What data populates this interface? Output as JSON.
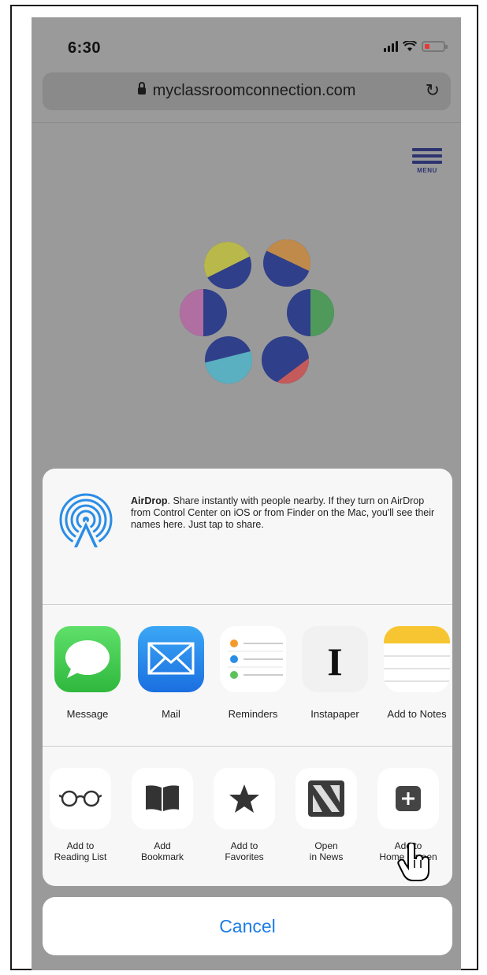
{
  "status_bar": {
    "time": "6:30",
    "battery_color": "#e53935"
  },
  "url_bar": {
    "url": "myclassroomconnection.com"
  },
  "site": {
    "menu_label": "Menu"
  },
  "share_sheet": {
    "airdrop": {
      "title": "AirDrop",
      "description": ". Share instantly with people nearby. If they turn on AirDrop from Control Center on iOS or from Finder on the Mac, you'll see their names here. Just tap to share."
    },
    "apps": [
      {
        "label": "Message",
        "icon": "message-icon"
      },
      {
        "label": "Mail",
        "icon": "mail-icon"
      },
      {
        "label": "Reminders",
        "icon": "reminders-icon"
      },
      {
        "label": "Instapaper",
        "icon": "instapaper-icon"
      },
      {
        "label": "Add to Notes",
        "icon": "notes-icon"
      }
    ],
    "actions": [
      {
        "line1": "Add to",
        "line2": "Reading List",
        "icon": "glasses-icon"
      },
      {
        "line1": "Add",
        "line2": "Bookmark",
        "icon": "book-icon"
      },
      {
        "line1": "Add to",
        "line2": "Favorites",
        "icon": "star-icon"
      },
      {
        "line1": "Open",
        "line2": "in News",
        "icon": "news-icon"
      },
      {
        "line1": "Add to",
        "line2": "Home Screen",
        "icon": "plus-square-icon"
      }
    ],
    "cancel_label": "Cancel"
  },
  "colors": {
    "accent": "#1d7de4",
    "overlay": "#9a9a9a",
    "sheet": "#f7f7f7"
  }
}
